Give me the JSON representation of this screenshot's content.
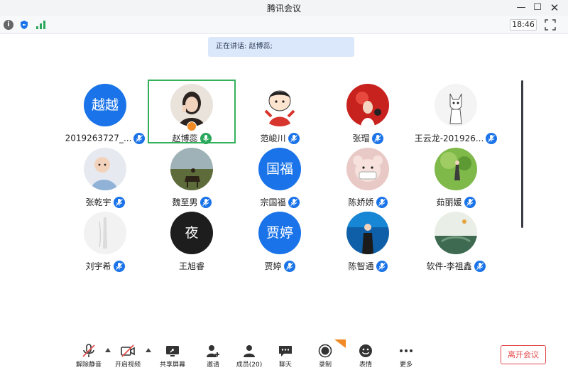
{
  "window": {
    "title": "腾讯会议"
  },
  "infobar": {
    "clock": "18:46",
    "info_glyph": "i"
  },
  "speaking": {
    "text": "正在讲话: 赵博蕊;"
  },
  "participants": [
    {
      "name": "2019263727_...",
      "avatar_text": "越越"
    },
    {
      "name": "赵博蕊",
      "active": true
    },
    {
      "name": "范峻川"
    },
    {
      "name": "张瑁"
    },
    {
      "name": "王云龙-201926..."
    },
    {
      "name": "张乾宇"
    },
    {
      "name": "魏至男"
    },
    {
      "name": "宗国福",
      "avatar_text": "国福"
    },
    {
      "name": "陈娇娇"
    },
    {
      "name": "茹丽媛"
    },
    {
      "name": "刘宇希"
    },
    {
      "name": "王旭睿",
      "avatar_text": "夜"
    },
    {
      "name": "贾婷",
      "avatar_text": "贾婷"
    },
    {
      "name": "陈智通"
    },
    {
      "name": "软件-李祖鑫"
    }
  ],
  "toolbar": {
    "unmute": "解除静音",
    "start_video": "开启视频",
    "share_screen": "共享屏幕",
    "invite": "邀请",
    "members": "成员(20)",
    "chat": "聊天",
    "record": "录制",
    "reactions": "表情",
    "more": "更多",
    "leave": "离开会议"
  },
  "colors": {
    "accent": "#1a73e8",
    "active_border": "#34b15b",
    "leave": "#e34d4d",
    "speaking_bg": "#dbe8fb"
  }
}
